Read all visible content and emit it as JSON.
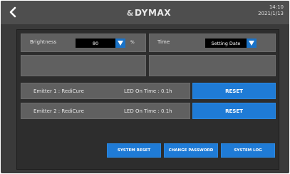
{
  "header": {
    "brand": "DYMAX",
    "time": "14:10",
    "date": "2021/1/13"
  },
  "settings": {
    "brightness_label": "Brightness",
    "brightness_value": "80",
    "brightness_unit": "%",
    "time_label": "Time",
    "time_value": "Setting Date"
  },
  "emitters": [
    {
      "name": "Emitter 1 : RediCure",
      "led_on_time": "LED On Time : 0.1h",
      "reset_label": "RESET"
    },
    {
      "name": "Emitter 2 : RediCure",
      "led_on_time": "LED On Time : 0.1h",
      "reset_label": "RESET"
    }
  ],
  "footer": {
    "system_reset": "SYSTEM RESET",
    "change_password": "CHANGE PASSWORD",
    "system_log": "SYSTEM LOG"
  },
  "colors": {
    "accent": "#1f7bd6",
    "background": "#3a3a3a",
    "panel": "#2d2d2d",
    "card": "#606060"
  },
  "icons": {
    "back": "chevron-left-icon",
    "dropdown": "triangle-down-icon",
    "logo": "dymax-logo-icon"
  }
}
